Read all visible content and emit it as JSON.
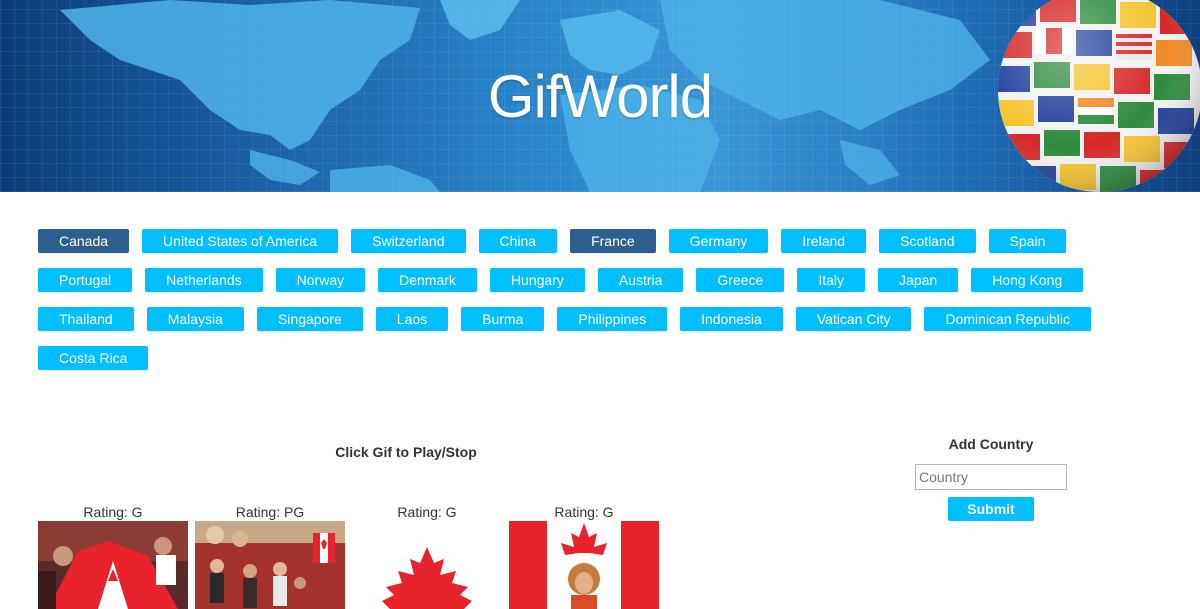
{
  "banner": {
    "title": "GifWorld"
  },
  "colors": {
    "button": "#00bfff",
    "button_active": "#2d5f8e",
    "banner_dark": "#0c3c7a",
    "banner_light": "#3a96d8",
    "flag_red": "#e8232b"
  },
  "countries": [
    {
      "label": "Canada",
      "active": true
    },
    {
      "label": "United States of America",
      "active": false
    },
    {
      "label": "Switzerland",
      "active": false
    },
    {
      "label": "China",
      "active": false
    },
    {
      "label": "France",
      "active": true
    },
    {
      "label": "Germany",
      "active": false
    },
    {
      "label": "Ireland",
      "active": false
    },
    {
      "label": "Scotland",
      "active": false
    },
    {
      "label": "Spain",
      "active": false
    },
    {
      "label": "Portugal",
      "active": false
    },
    {
      "label": "Netherlands",
      "active": false
    },
    {
      "label": "Norway",
      "active": false
    },
    {
      "label": "Denmark",
      "active": false
    },
    {
      "label": "Hungary",
      "active": false
    },
    {
      "label": "Austria",
      "active": false
    },
    {
      "label": "Greece",
      "active": false
    },
    {
      "label": "Italy",
      "active": false
    },
    {
      "label": "Japan",
      "active": false
    },
    {
      "label": "Hong Kong",
      "active": false
    },
    {
      "label": "Thailand",
      "active": false
    },
    {
      "label": "Malaysia",
      "active": false
    },
    {
      "label": "Singapore",
      "active": false
    },
    {
      "label": "Laos",
      "active": false
    },
    {
      "label": "Burma",
      "active": false
    },
    {
      "label": "Philippines",
      "active": false
    },
    {
      "label": "Indonesia",
      "active": false
    },
    {
      "label": "Vatican City",
      "active": false
    },
    {
      "label": "Dominican Republic",
      "active": false
    },
    {
      "label": "Costa Rica",
      "active": false
    }
  ],
  "gifs": {
    "instruction": "Click Gif to Play/Stop",
    "items": [
      {
        "rating": "Rating: G",
        "subject": "hockey-fans-with-flag"
      },
      {
        "rating": "Rating: PG",
        "subject": "party-crowd-with-flag"
      },
      {
        "rating": "Rating: G",
        "subject": "maple-leaf"
      },
      {
        "rating": "Rating: G",
        "subject": "canada-flag-with-singer"
      }
    ]
  },
  "add_country": {
    "title": "Add Country",
    "input_placeholder": "Country",
    "input_value": "",
    "submit_label": "Submit"
  }
}
